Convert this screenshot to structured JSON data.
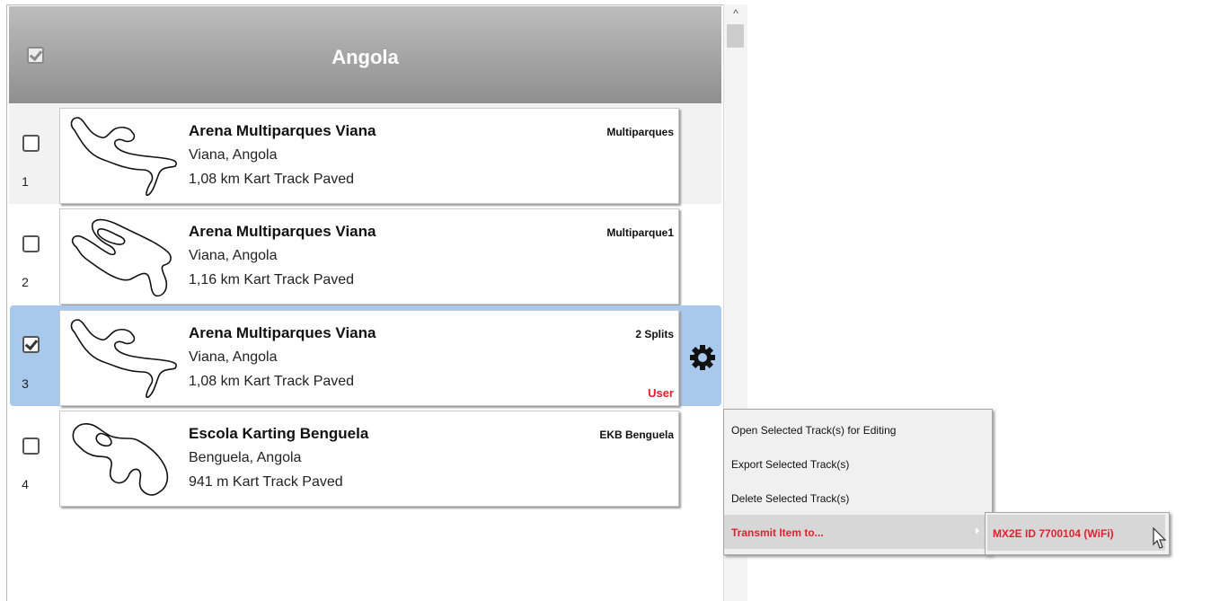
{
  "group": {
    "title": "Angola",
    "checked": true
  },
  "tracks": [
    {
      "num": "1",
      "name": "Arena Multiparques Viana",
      "location": "Viana, Angola",
      "length": "1,08 km Kart Track Paved",
      "tag": "Multiparques",
      "user": "",
      "checked": false
    },
    {
      "num": "2",
      "name": "Arena Multiparques Viana",
      "location": "Viana, Angola",
      "length": "1,16 km Kart Track Paved",
      "tag": "Multiparque1",
      "user": "",
      "checked": false
    },
    {
      "num": "3",
      "name": "Arena Multiparques Viana",
      "location": "Viana, Angola",
      "length": "1,08 km Kart Track Paved",
      "tag": "2 Splits",
      "user": "User",
      "checked": true
    },
    {
      "num": "4",
      "name": "Escola Karting Benguela",
      "location": "Benguela, Angola",
      "length": "941 m Kart Track Paved",
      "tag": "EKB Benguela",
      "user": "",
      "checked": false
    }
  ],
  "scrollbar": {
    "up_arrow": "^"
  },
  "context_menu": {
    "items": [
      "Open Selected Track(s) for Editing",
      "Export Selected Track(s)",
      "Delete Selected Track(s)",
      "Transmit Item to..."
    ],
    "submenu": [
      "MX2E ID 7700104 (WiFi)"
    ]
  },
  "colors": {
    "selection": "#a8c8ec",
    "accent_red": "#e0212f",
    "header_gray": "#a0a0a0"
  }
}
